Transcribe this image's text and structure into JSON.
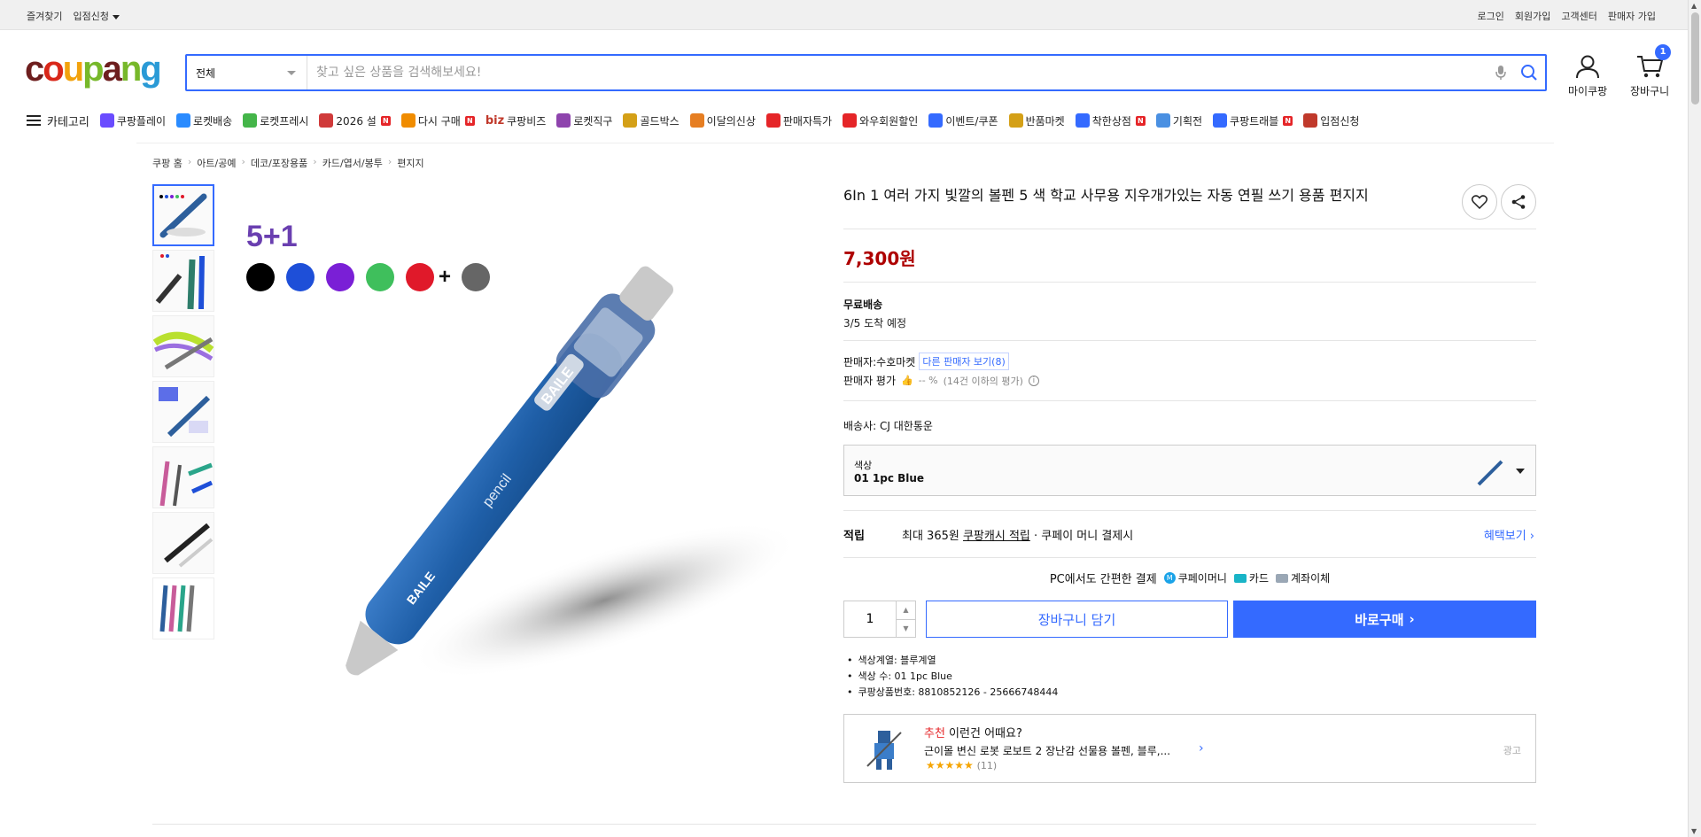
{
  "topbar": {
    "left": [
      "즐겨찾기",
      "입점신청"
    ],
    "right": [
      "로그인",
      "회원가입",
      "고객센터",
      "판매자 가입"
    ]
  },
  "header": {
    "logo": "coupang",
    "search_category": "전체",
    "search_placeholder": "찾고 싶은 상품을 검색해보세요!",
    "my_label": "마이쿠팡",
    "cart_label": "장바구니",
    "cart_count": "1"
  },
  "nav": {
    "category_label": "카테고리",
    "items": [
      {
        "label": "쿠팡플레이",
        "color": "#6a4cff"
      },
      {
        "label": "로켓배송",
        "color": "#2a8bff"
      },
      {
        "label": "로켓프레시",
        "color": "#44b549"
      },
      {
        "label": "2026 설",
        "color": "#d03a3a",
        "new": "N"
      },
      {
        "label": "다시 구매",
        "color": "#f08c00",
        "new": "N"
      },
      {
        "label": "쿠팡비즈",
        "color": "#c0392b",
        "prefix": "biz"
      },
      {
        "label": "로켓직구",
        "color": "#8e44ad"
      },
      {
        "label": "골드박스",
        "color": "#d4a017"
      },
      {
        "label": "이달의신상",
        "color": "#e67e22"
      },
      {
        "label": "판매자특가",
        "color": "#e52528"
      },
      {
        "label": "와우회원할인",
        "color": "#e52528"
      },
      {
        "label": "이벤트/쿠폰",
        "color": "#346aff"
      },
      {
        "label": "반품마켓",
        "color": "#d4a017"
      },
      {
        "label": "착한상점",
        "color": "#346aff",
        "new": "N"
      },
      {
        "label": "기획전",
        "color": "#4a90e2"
      },
      {
        "label": "쿠팡트래블",
        "color": "#346aff",
        "new": "N"
      },
      {
        "label": "입점신청",
        "color": "#c0392b"
      }
    ]
  },
  "breadcrumb": [
    "쿠팡 홈",
    "아트/공예",
    "데코/포장용품",
    "카드/엽서/봉투",
    "편지지"
  ],
  "product": {
    "title": "6In 1 여러 가지 빛깔의 볼펜 5 색 학교 사무용 지우개가있는 자동 연필 쓰기 용품 편지지",
    "price": "7,300원",
    "shipping_title": "무료배송",
    "arrival": "3/5 도착 예정",
    "seller_label": "판매자:",
    "seller_name": "수호마켓",
    "other_sellers": "다른 판매자 보기(8)",
    "rating_label": "판매자 평가",
    "rating_value": "-- %",
    "rating_note": "(14건 이하의 평가)",
    "carrier_label": "배송사:",
    "carrier_name": "CJ 대한통운",
    "option_label": "색상",
    "option_value": "01 1pc Blue",
    "reward_title": "적립",
    "reward_text1": "최대 365원",
    "reward_text2": "쿠팡캐시 적립",
    "reward_text3": "· 쿠페이 머니 결제시",
    "reward_more": "혜택보기",
    "pay_title": "PC에서도 간편한 결제",
    "pay_methods": [
      "쿠페이머니",
      "카드",
      "계좌이체"
    ],
    "qty": "1",
    "cart_btn": "장바구니 담기",
    "buy_btn": "바로구매",
    "attributes": [
      "색상계열: 블루계열",
      "색상 수: 01 1pc Blue",
      "쿠팡상품번호: 8810852126 - 25666748444"
    ],
    "pen_brand": "BAILE",
    "pen_word": "pencil",
    "image_badge": "5+1",
    "swatches": [
      "#000000",
      "#1e4fd8",
      "#7a1fd6",
      "#3fbf5c",
      "#e0192a",
      "#666666"
    ]
  },
  "reco": {
    "title_red": "추천",
    "title_rest": " 이런건 어때요?",
    "name": "근이몰 변신 로봇 로보트 2 장난감 선물용 볼펜, 블루,...",
    "stars": "★★★★★",
    "count": "(11)",
    "ad": "광고"
  }
}
